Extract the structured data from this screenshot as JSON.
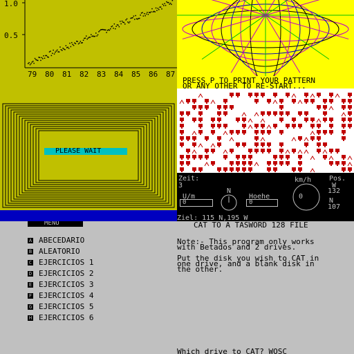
{
  "chart": {
    "y_ticks": [
      "1.0",
      "0.5"
    ],
    "x_ticks": [
      "79",
      "80",
      "81",
      "82",
      "83",
      "84",
      "85",
      "86",
      "87"
    ]
  },
  "pattern": {
    "line1": "PRESS P TO PRINT YOUR PATTERN",
    "line2": "OR ANY OTHER TO RE-START..."
  },
  "wait": {
    "label": "PLEASE WAIT"
  },
  "dashboard": {
    "zeit_label": "Zeit:",
    "zeit_value": "3",
    "kmh_label": "km/h",
    "pos_label": "Pos.",
    "w_label": "W",
    "w_value": "132",
    "n_compass": "N",
    "um_label": "U/m",
    "um_value": "0",
    "hoehe_label": "Hoehe",
    "hoehe_value": "0",
    "speed_value": "0",
    "n_label": "N",
    "n_value": "107",
    "ziel_label": "Ziel: 115 N,195 W"
  },
  "menu": {
    "title": "MENU",
    "items": [
      {
        "key": "A",
        "label": "ABECEDARIO"
      },
      {
        "key": "B",
        "label": "ALEATORIO"
      },
      {
        "key": "C",
        "label": "EJERCICIOS 1"
      },
      {
        "key": "D",
        "label": "EJERCICIOS 2"
      },
      {
        "key": "E",
        "label": "EJERCICIOS 3"
      },
      {
        "key": "F",
        "label": "EJERCICIOS 4"
      },
      {
        "key": "G",
        "label": "EJERCICIOS 5"
      },
      {
        "key": "H",
        "label": "EJERCICIOS 6"
      }
    ]
  },
  "tasword": {
    "title": "CAT TO A TASWORD 128 FILE",
    "note1": "Note:- This program only works",
    "note2": "with Betados and 2 drives.",
    "put1": "Put the disk you wish to CAT in",
    "put2": "one drive, and a blank disk in",
    "put3": "the other.",
    "prompt": "Which drive to CAT? WOSC"
  },
  "colors": {
    "olive": "#c0c000",
    "yellow": "#ffff00",
    "cyan": "#00c0c0",
    "blue": "#0000c0",
    "red": "#c00000",
    "grey": "#c0c0c0"
  }
}
